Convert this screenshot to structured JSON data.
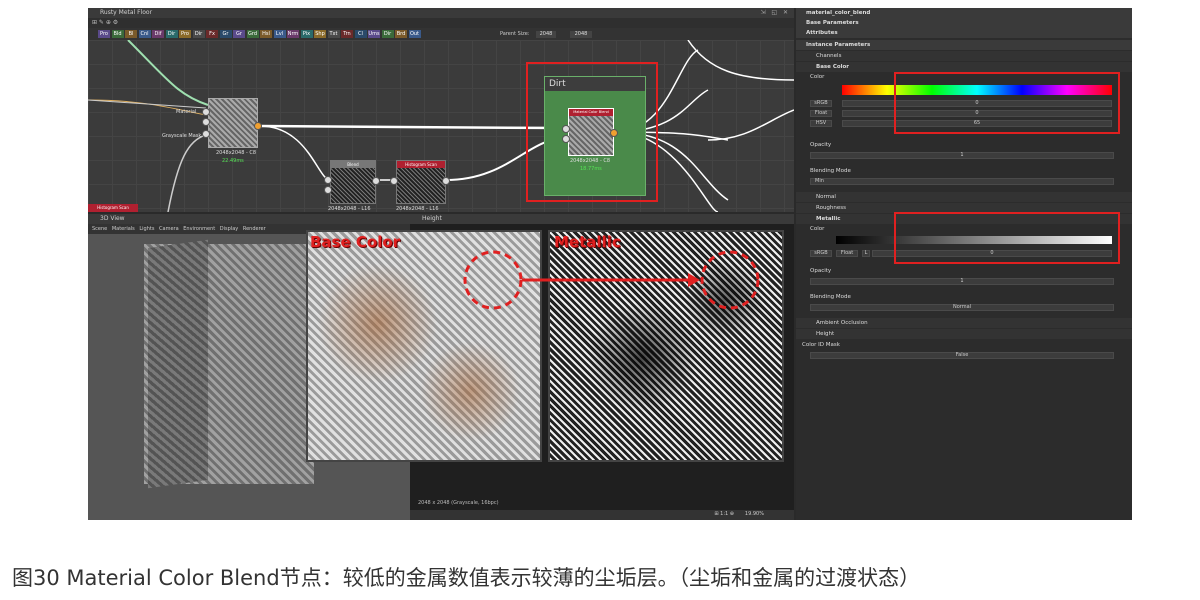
{
  "graph_window": {
    "title": "Rusty Metal Floor"
  },
  "toolbar_buttons": [
    "Pro",
    "Bld",
    "Bl",
    "Cnl",
    "Dif",
    "Dir",
    "Pro",
    "Dir",
    "Fx",
    "Gr",
    "Gr",
    "Grd",
    "Hsl",
    "Lvl",
    "Nrm",
    "Pix",
    "Shp",
    "Txt",
    "Trn",
    "Cl",
    "Ums",
    "Dir",
    "Brd",
    "Out"
  ],
  "parent_size": {
    "label": "Parent Size:",
    "value": "2048",
    "value2": "2048"
  },
  "frame": {
    "title": "Dirt"
  },
  "nodes": {
    "left": {
      "ports": [
        "Material",
        "Grayscale Mask"
      ],
      "res": "2048x2048 - C8",
      "time": "22.49ms"
    },
    "blend": {
      "title": "Blend",
      "res": "2048x2048 - L16"
    },
    "histogram": {
      "title": "Histogram Scan",
      "res": "2048x2048 - L16"
    },
    "mcb": {
      "title": "Material Color Blend",
      "res": "2048x2048 - C8",
      "time": "18.77ms"
    },
    "bottom_left": {
      "title": "Histogram Scan"
    }
  },
  "view3d": {
    "title": "3D View",
    "menu": [
      "Scene",
      "Materials",
      "Lights",
      "Camera",
      "Environment",
      "Display",
      "Renderer"
    ]
  },
  "height_view": {
    "title": "Height",
    "status": "2048 x 2048 (Grayscale, 16bpc)",
    "zoom": "19.90%",
    "icons": "⊞ 1:1 ⊕"
  },
  "overlays": {
    "base_color": "Base Color",
    "metallic": "Metallic"
  },
  "props": {
    "title": "material_color_blend",
    "sections": [
      "Base Parameters",
      "Attributes",
      "Instance Parameters"
    ],
    "channels": "Channels",
    "base_color": {
      "header": "Base Color",
      "color_label": "Color",
      "mode": "sRGB",
      "type": "Float",
      "hsv": "HSV",
      "values": [
        "0",
        "0",
        "65"
      ],
      "opacity_label": "Opacity",
      "opacity_value": "1",
      "blend_label": "Blending Mode",
      "blend_value": "Min"
    },
    "normal": "Normal",
    "roughness": "Roughness",
    "metallic": {
      "header": "Metallic",
      "color_label": "Color",
      "mode": "sRGB",
      "type": "Float",
      "l": "L",
      "value": "0",
      "opacity_label": "Opacity",
      "opacity_value": "1",
      "blend_label": "Blending Mode",
      "blend_value": "Normal"
    },
    "ambient": "Ambient Occlusion",
    "height": "Height",
    "id_mask": {
      "label": "Color ID Mask",
      "value": "False"
    }
  },
  "caption": "图30 Material Color Blend节点：较低的金属数值表示较薄的尘垢层。（尘垢和金属的过渡状态）",
  "colors": {
    "highlight": "#e02020",
    "frame": "#4a8a4a",
    "value_green": "#56e356"
  }
}
